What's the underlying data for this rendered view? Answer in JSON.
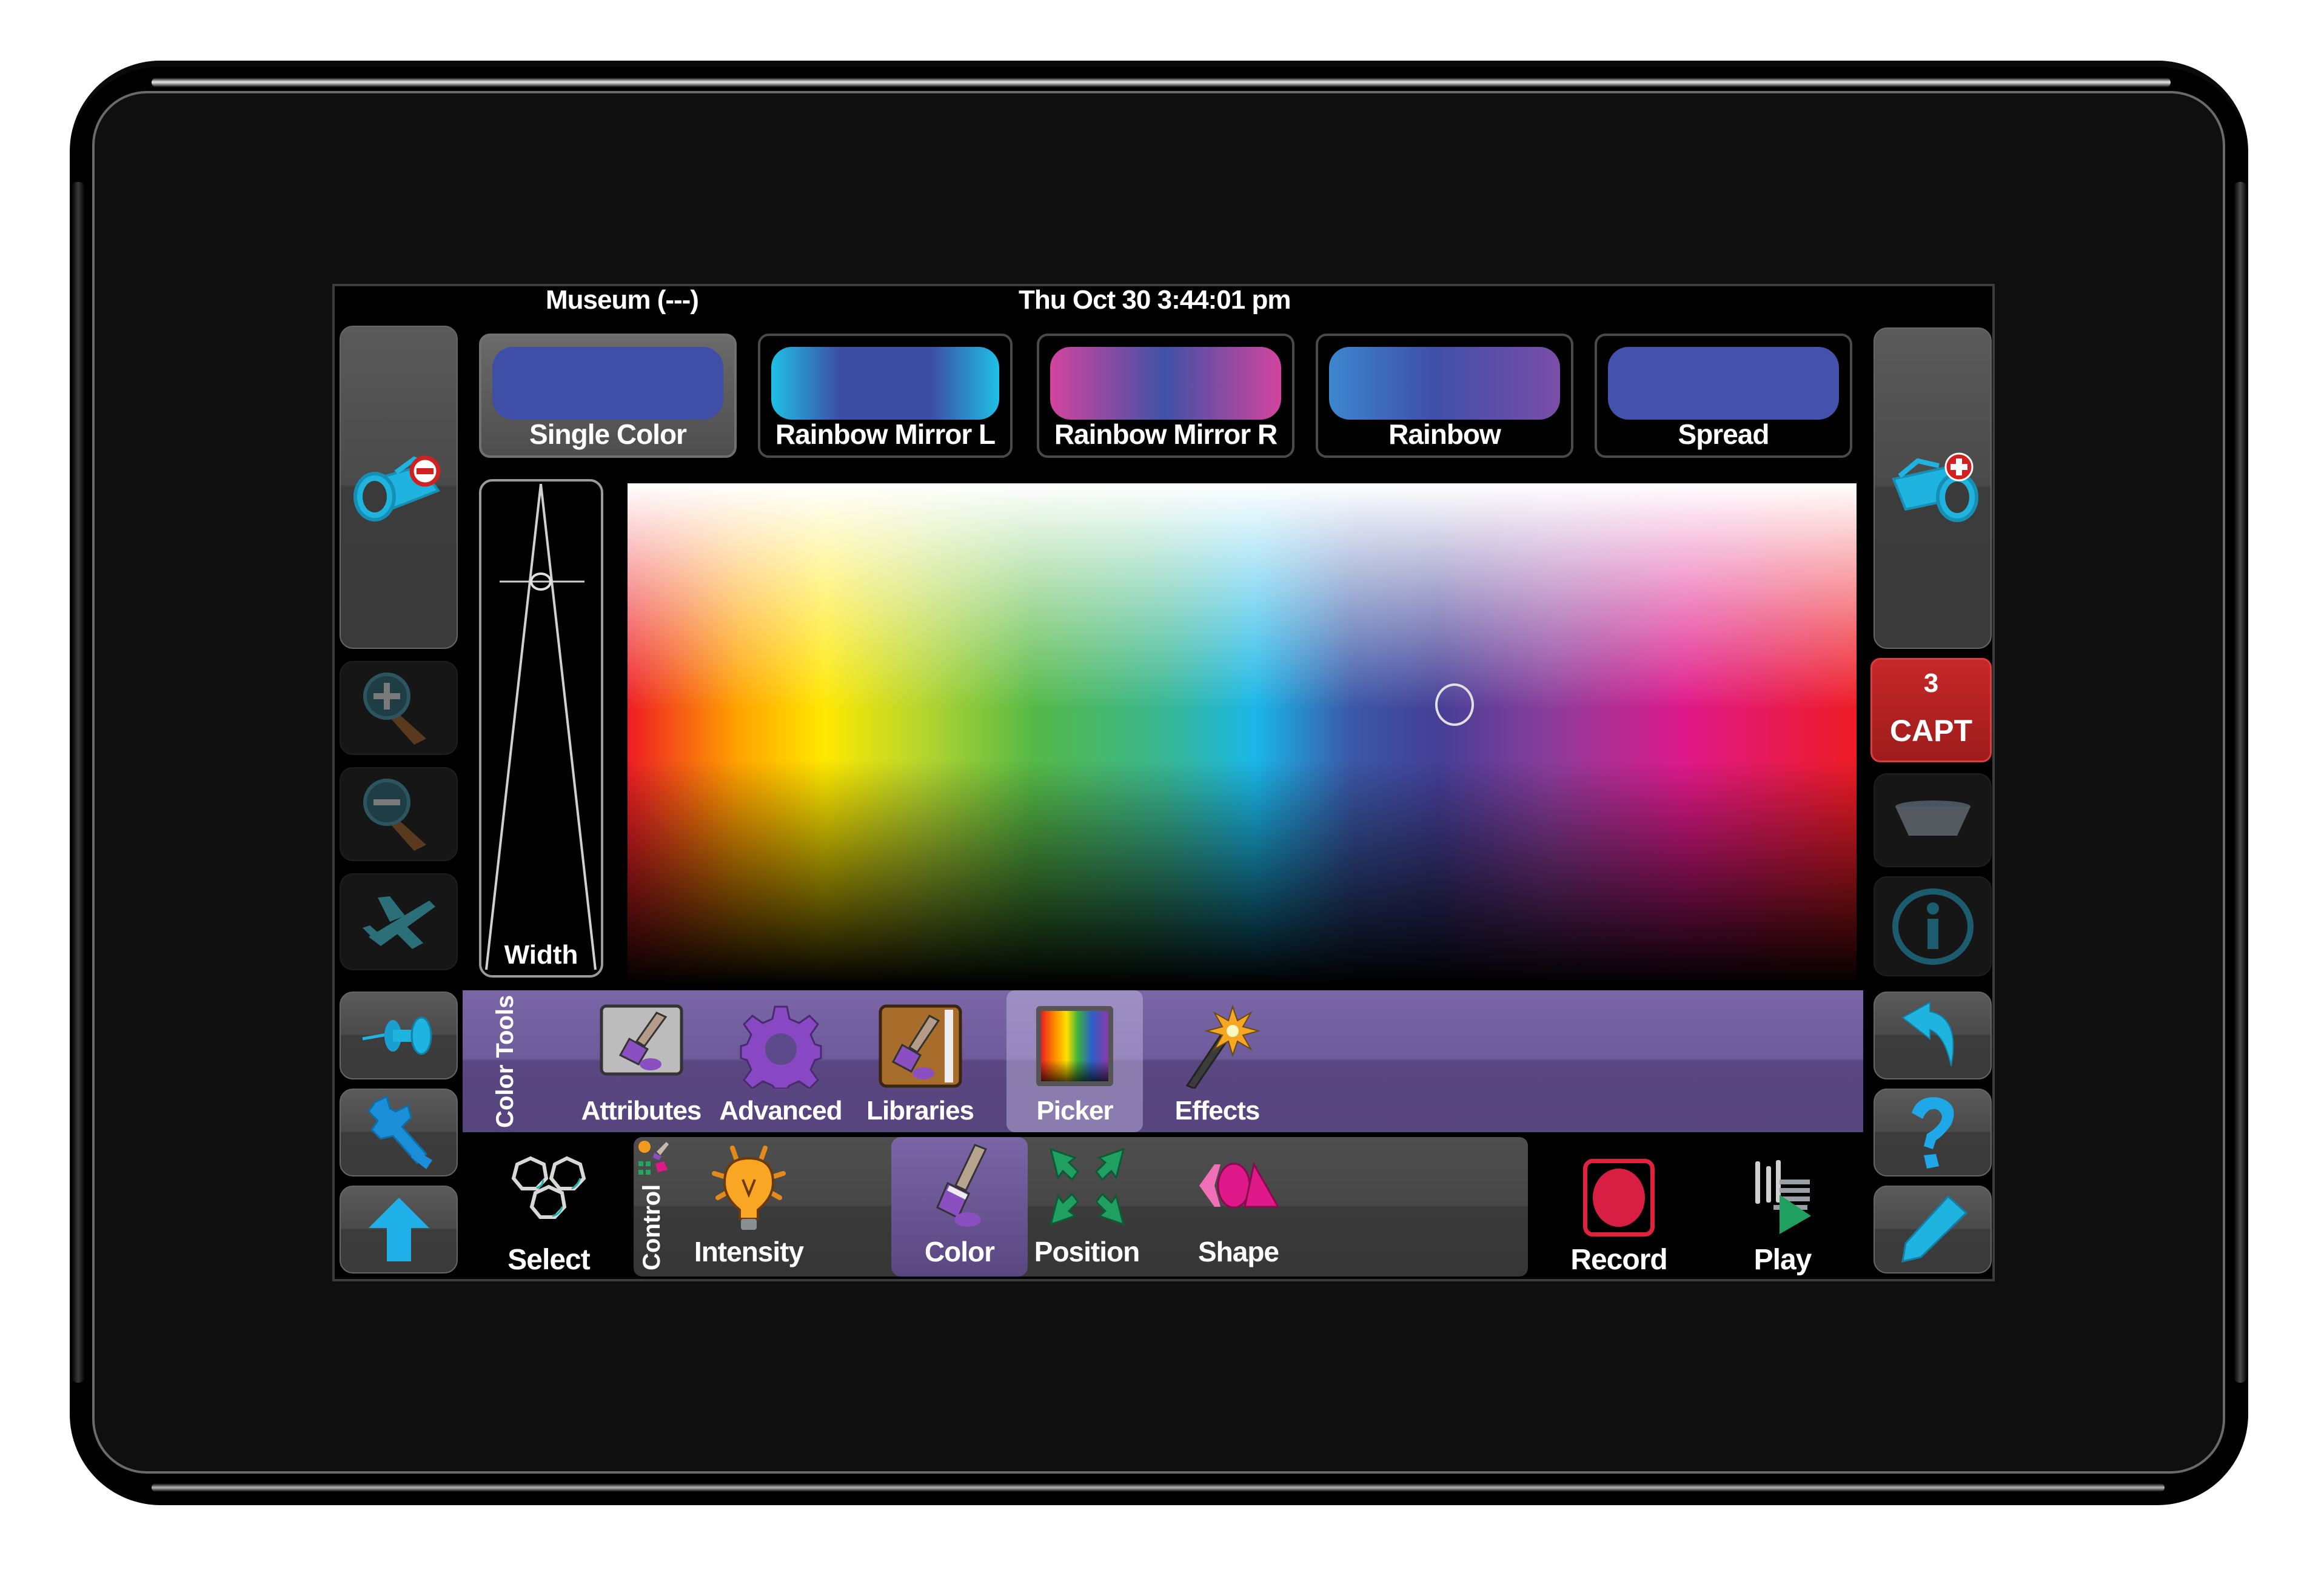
{
  "header": {
    "location": "Museum (---)",
    "datetime": "Thu Oct 30 3:44:01 pm"
  },
  "presets": [
    {
      "label": "Single Color",
      "selected": true,
      "swatch": [
        "#3f4fa7",
        "#3f4fa7"
      ]
    },
    {
      "label": "Rainbow Mirror L",
      "selected": false,
      "swatch": [
        "#1fc0e6",
        "#3c4ea4",
        "#1fc0e6"
      ]
    },
    {
      "label": "Rainbow Mirror R",
      "selected": false,
      "swatch": [
        "#d2449e",
        "#3f52a6",
        "#d2449e"
      ]
    },
    {
      "label": "Rainbow",
      "selected": false,
      "swatch": [
        "#3d86d0",
        "#3f4fa7",
        "#7a4ea8"
      ]
    },
    {
      "label": "Spread",
      "selected": false,
      "swatch": [
        "#4452ae",
        "#4452ae"
      ]
    }
  ],
  "width_slider": {
    "label": "Width"
  },
  "picker": {
    "cursor_hue": "blue",
    "cursor_color": "#3f4fa7"
  },
  "left_sidebar": [
    {
      "name": "remove-fixture",
      "icon": "spotlight-minus-icon"
    },
    {
      "name": "zoom-in",
      "icon": "zoom-in-icon",
      "disabled": true
    },
    {
      "name": "zoom-out",
      "icon": "zoom-out-icon",
      "disabled": true
    },
    {
      "name": "fly",
      "icon": "airplane-icon",
      "disabled": true
    },
    {
      "name": "pin",
      "icon": "pushpin-icon"
    },
    {
      "name": "settings",
      "icon": "wrench-icon"
    },
    {
      "name": "up",
      "icon": "arrow-up-icon"
    }
  ],
  "right_sidebar": {
    "add_fixture": {
      "icon": "spotlight-plus-icon"
    },
    "capture": {
      "count": "3",
      "label": "CAPT"
    },
    "clear": {
      "icon": "bowl-icon",
      "disabled": true
    },
    "info": {
      "icon": "info-icon",
      "disabled": true
    },
    "undo": {
      "icon": "undo-icon"
    },
    "help": {
      "icon": "help-icon"
    },
    "edit": {
      "icon": "pencil-icon"
    }
  },
  "color_tools": {
    "title": "Color Tools",
    "items": [
      {
        "label": "Attributes",
        "icon": "paintbrush-card-icon"
      },
      {
        "label": "Advanced",
        "icon": "gear-icon"
      },
      {
        "label": "Libraries",
        "icon": "paintbrush-book-icon"
      },
      {
        "label": "Picker",
        "icon": "rainbow-icon",
        "selected": true
      },
      {
        "label": "Effects",
        "icon": "magic-wand-icon"
      }
    ]
  },
  "bottom_bar": {
    "select": {
      "label": "Select",
      "icon": "hex-rings-icon"
    },
    "control_title": "Control",
    "control_items": [
      {
        "label": "Intensity",
        "icon": "lightbulb-icon"
      },
      {
        "label": "Color",
        "icon": "paintbrush-icon",
        "selected": true
      },
      {
        "label": "Position",
        "icon": "position-arrows-icon"
      },
      {
        "label": "Shape",
        "icon": "shape-icon"
      }
    ],
    "record": {
      "label": "Record",
      "icon": "record-icon"
    },
    "play": {
      "label": "Play",
      "icon": "play-icon"
    }
  },
  "colors": {
    "accent_purple": "#6e5b9c",
    "icon_cyan": "#1fb4e0",
    "capture_red": "#b52222",
    "record_red": "#e0223f"
  }
}
